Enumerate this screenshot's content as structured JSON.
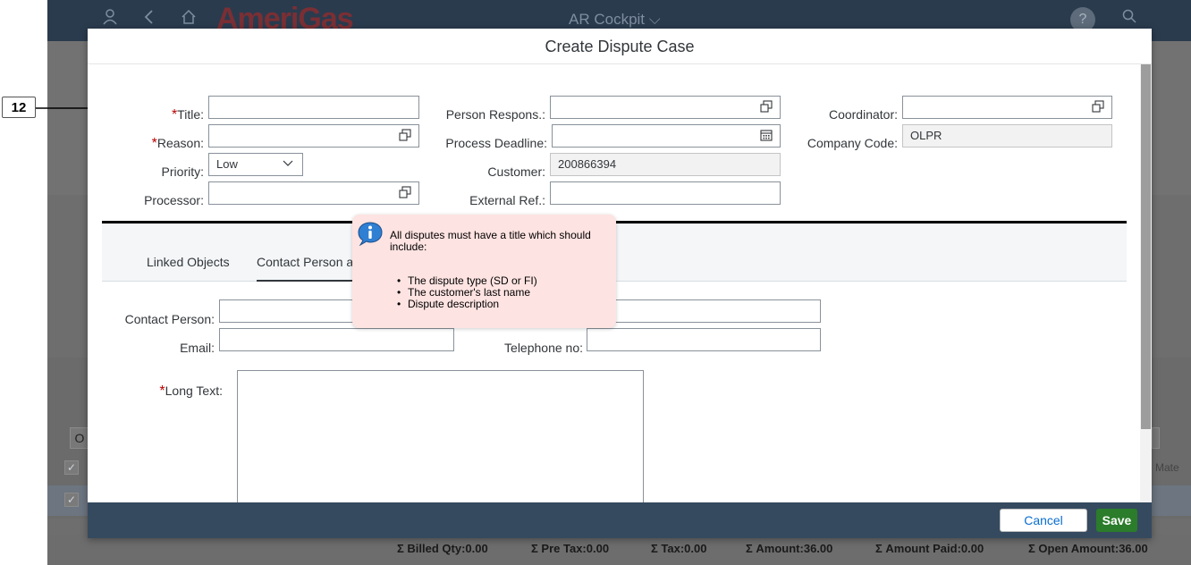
{
  "step_badge": "12",
  "shell": {
    "brand": "AmeriGas",
    "app_title": "AR Cockpit",
    "help": "?"
  },
  "dialog": {
    "title": "Create Dispute Case",
    "fields": {
      "title_label": "Title:",
      "reason_label": "Reason:",
      "priority_label": "Priority:",
      "priority_value": "Low",
      "processor_label": "Processor:",
      "person_responsible_label": "Person Respons.:",
      "process_deadline_label": "Process Deadline:",
      "customer_label": "Customer:",
      "customer_value": "200866394",
      "external_ref_label": "External Ref.:",
      "coordinator_label": "Coordinator:",
      "company_code_label": "Company Code:",
      "company_code_value": "OLPR"
    },
    "tabs": [
      "Linked Objects",
      "Contact Person a"
    ],
    "contact": {
      "contact_person_label": "Contact Person:",
      "email_label": "Email:",
      "telephone_label": "Telephone no:",
      "long_text_label": "Long Text:"
    },
    "footer": {
      "cancel": "Cancel",
      "save": "Save"
    }
  },
  "tooltip": {
    "text": "All disputes must have a title which should include:",
    "items": [
      "The dispute type (SD or FI)",
      "The customer's last name",
      "Dispute description"
    ]
  },
  "background": {
    "o_button": "O",
    "column_fragment": "Mate"
  },
  "totals": {
    "billed_qty": "Σ Billed Qty:0.00",
    "pre_tax": "Σ Pre Tax:0.00",
    "tax": "Σ Tax:0.00",
    "amount": "Σ Amount:36.00",
    "amount_paid": "Σ Amount Paid:0.00",
    "open_amount": "Σ Open Amount:36.00"
  },
  "colors": {
    "shell": "#2a3b4e",
    "dialog_footer": "#354a5f",
    "save_button": "#2b7c2b",
    "required": "#bb0000",
    "tooltip_bg": "#fde3e1"
  }
}
